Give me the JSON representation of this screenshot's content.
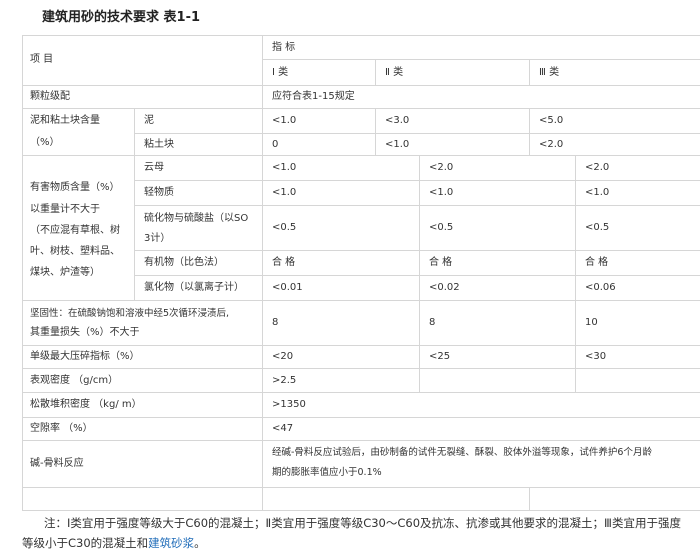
{
  "title": "建筑用砂的技术要求 表1-1",
  "table": {
    "header": {
      "item": "项 目",
      "index": "指 标",
      "class1": "Ⅰ 类",
      "class2": "Ⅱ 类",
      "class3": "Ⅲ 类"
    },
    "gradation": {
      "label": "颗粒级配",
      "value": "应符合表1-15规定"
    },
    "mud": {
      "label_line1": "泥和粘土块含量",
      "label_line2": "（%）",
      "rows": [
        {
          "name": "泥",
          "v1": "<1.0",
          "v2": "<3.0",
          "v3": "<5.0"
        },
        {
          "name": "粘土块",
          "v1": "0",
          "v2": "<1.0",
          "v3": "<2.0"
        }
      ]
    },
    "harmful": {
      "label_lines": [
        "有害物质含量（%）",
        "以重量计不大于",
        "（不应混有草根、树",
        "叶、树枝、塑料品、",
        "煤块、炉渣等）"
      ],
      "rows": [
        {
          "name": "云母",
          "v1": "<1.0",
          "v2": "<2.0",
          "v3": "<2.0"
        },
        {
          "name": "轻物质",
          "v1": "<1.0",
          "v2": "<1.0",
          "v3": "<1.0"
        },
        {
          "name_line1": "硫化物与硫酸盐（以SO",
          "name_line2": "3计）",
          "v1": "<0.5",
          "v2": "<0.5",
          "v3": "<0.5"
        },
        {
          "name": "有机物（比色法）",
          "v1": "合 格",
          "v2": "合 格",
          "v3": "合 格"
        },
        {
          "name": "氯化物（以氯离子计）",
          "v1": "<0.01",
          "v2": "<0.02",
          "v3": "<0.06"
        }
      ]
    },
    "soundness": {
      "label_line1": "坚固性：在硫酸钠饱和溶液中经5次循环浸渍后,",
      "label_line2": "其重量损失（%）不大于",
      "v1": "8",
      "v2": "8",
      "v3": "10"
    },
    "crush": {
      "label": "单级最大压碎指标（%）",
      "v1": "<20",
      "v2": "<25",
      "v3": "<30"
    },
    "apparent_density": {
      "label": "表观密度 （g/cm）",
      "value": ">2.5"
    },
    "bulk_density": {
      "label": "松散堆积密度 （kg/ m）",
      "value": ">1350"
    },
    "voids": {
      "label": "空隙率 （%）",
      "value": "<47"
    },
    "alkali": {
      "label": "碱-骨料反应",
      "value_line1": "经碱-骨料反应试验后，由砂制备的试件无裂缝、酥裂、胶体外溢等现象，试件养护6个月龄",
      "value_line2": "期的膨胀率值应小于0.1%"
    }
  },
  "note": {
    "text": "注：Ⅰ类宜用于强度等级大于C60的混凝土；Ⅱ类宜用于强度等级C30～C60及抗冻、抗渗或其他要求的混凝土；Ⅲ类宜用于强度等级小于C30的混凝土和",
    "link": "建筑砂浆",
    "end": "。"
  }
}
